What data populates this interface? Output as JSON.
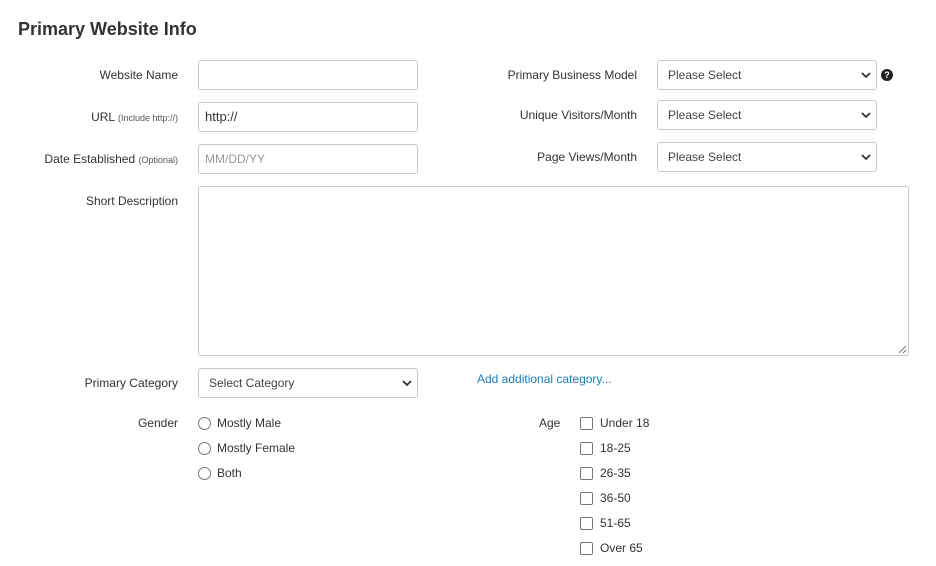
{
  "section_title": "Primary Website Info",
  "fields": {
    "website_name": {
      "label": "Website Name",
      "value": ""
    },
    "url": {
      "label": "URL",
      "hint": "(Include http://)",
      "value": "http://"
    },
    "date_established": {
      "label": "Date Established",
      "hint": "(Optional)",
      "placeholder": "MM/DD/YY"
    },
    "short_description": {
      "label": "Short Description",
      "value": ""
    },
    "primary_category": {
      "label": "Primary Category",
      "selected": "Select Category"
    },
    "add_category_link": "Add additional category...",
    "business_model": {
      "label": "Primary Business Model",
      "selected": "Please Select",
      "help_icon": "?"
    },
    "unique_visitors": {
      "label": "Unique Visitors/Month",
      "selected": "Please Select"
    },
    "page_views": {
      "label": "Page Views/Month",
      "selected": "Please Select"
    }
  },
  "gender": {
    "label": "Gender",
    "options": [
      "Mostly Male",
      "Mostly Female",
      "Both"
    ]
  },
  "age": {
    "label": "Age",
    "options": [
      "Under 18",
      "18-25",
      "26-35",
      "36-50",
      "51-65",
      "Over 65"
    ]
  },
  "colors": {
    "link": "#1a7fb8",
    "border": "#c8c8c8",
    "text": "#333333"
  }
}
